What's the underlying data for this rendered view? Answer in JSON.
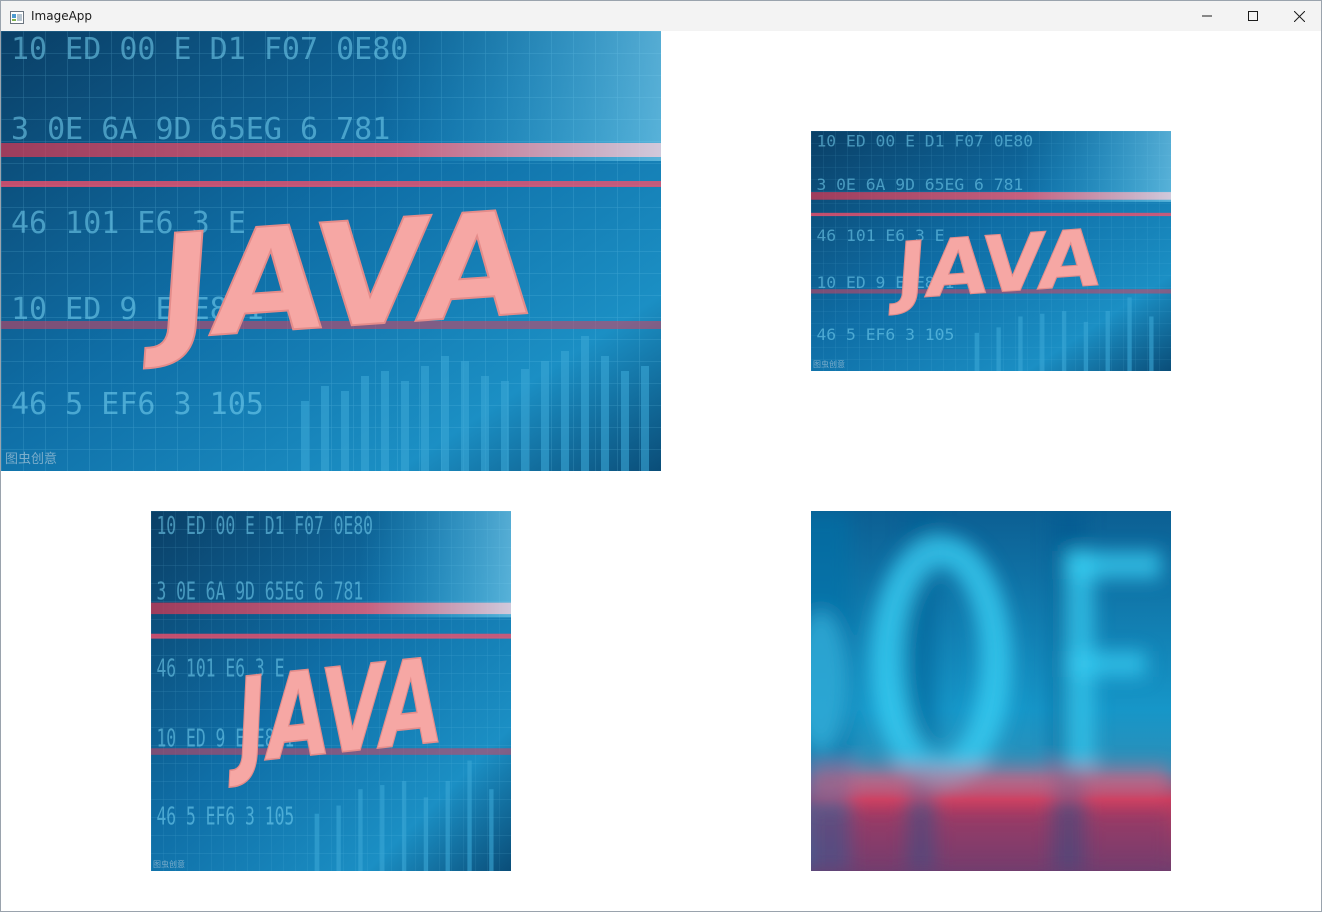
{
  "window": {
    "title": "ImageApp",
    "app_icon": "window-icon",
    "controls": [
      "minimize-icon",
      "maximize-icon",
      "close-icon"
    ]
  },
  "images": [
    {
      "name": "java-image-original",
      "word": "JAVA",
      "watermark": "图虫创意"
    },
    {
      "name": "java-image-scaled",
      "word": "JAVA",
      "watermark": "图虫创意"
    },
    {
      "name": "java-image-square",
      "word": "JAVA",
      "watermark": "图虫创意"
    },
    {
      "name": "java-image-blurred-crop"
    }
  ],
  "colors": {
    "background": "#ffffff",
    "titlebar": "#f3f3f3",
    "image_blue": "#0e6fa8",
    "image_cyan": "#35c7ee",
    "image_red": "#e2354f",
    "java_text": "#f6a7a4"
  }
}
